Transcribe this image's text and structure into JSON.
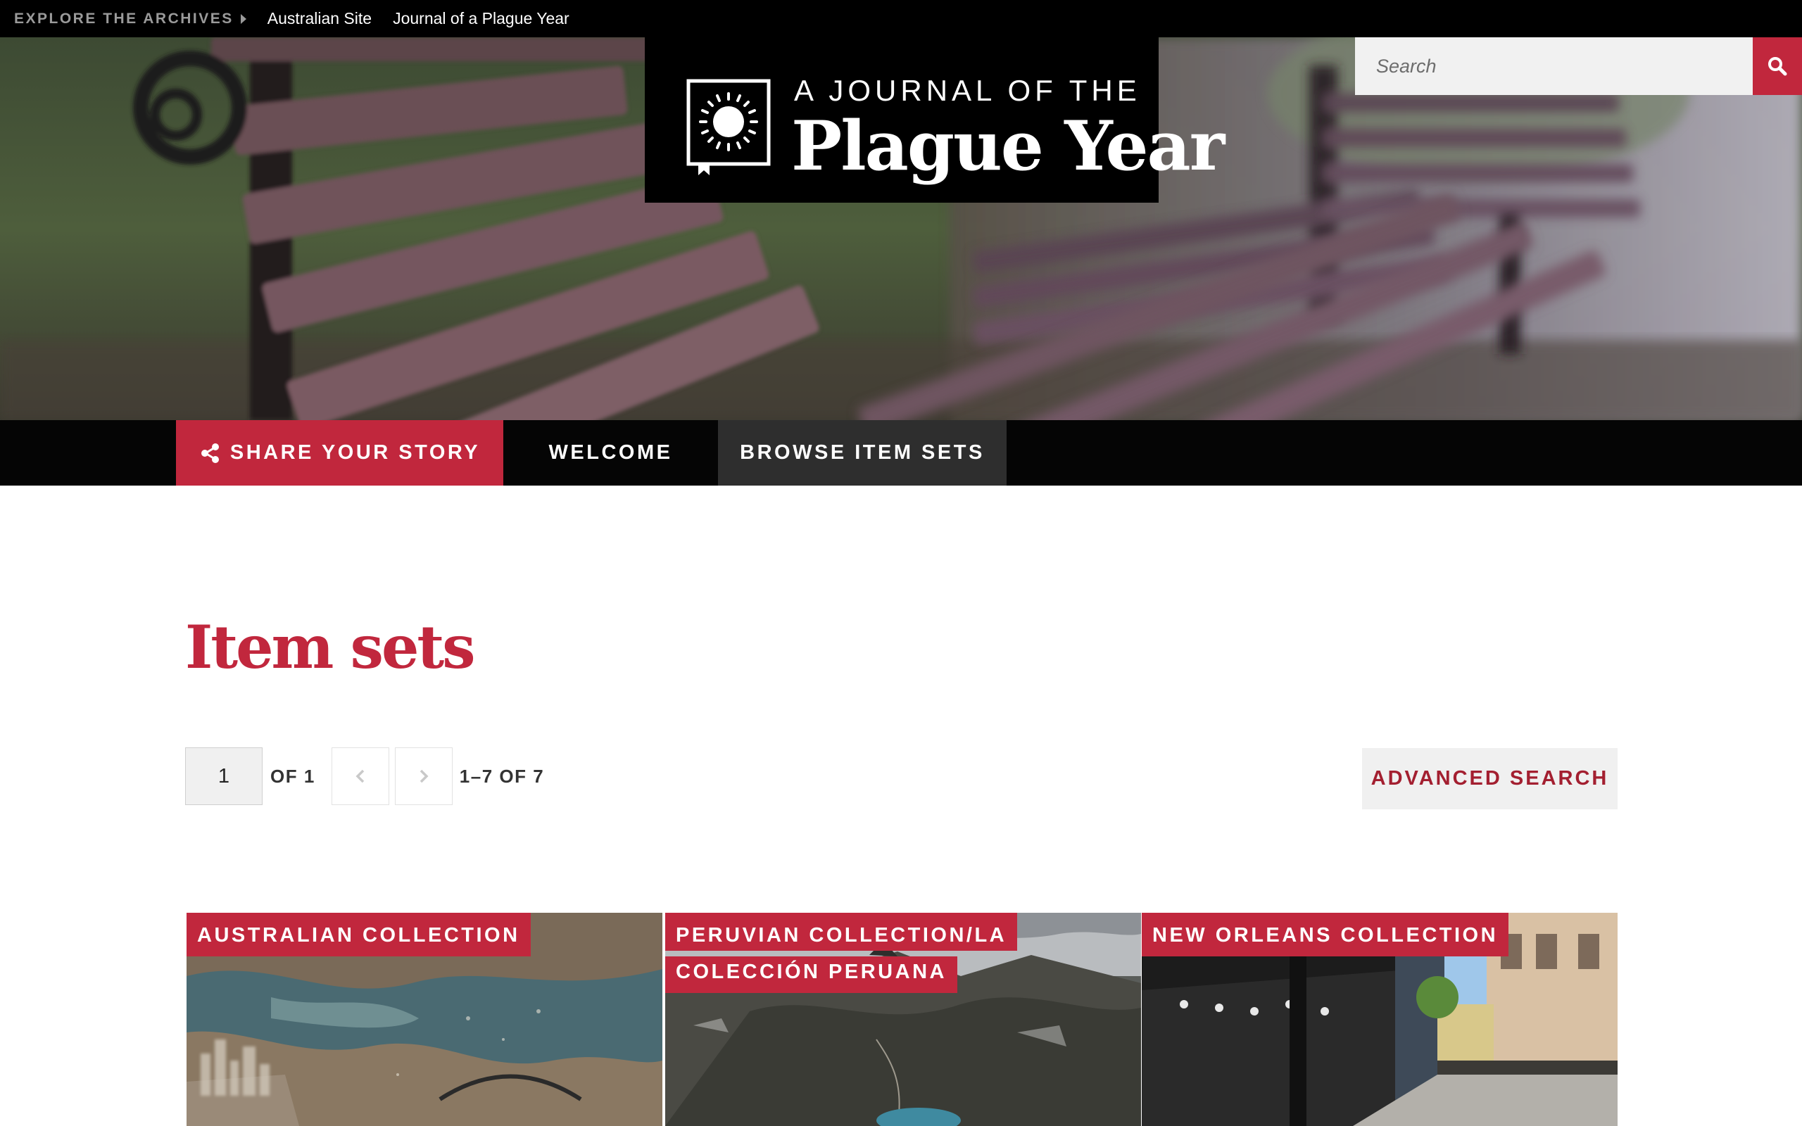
{
  "topbar": {
    "explore_label": "EXPLORE THE ARCHIVES",
    "links": [
      "Australian Site",
      "Journal of a Plague Year"
    ]
  },
  "logo": {
    "small_text": "A JOURNAL OF THE",
    "big_text": "Plague Year"
  },
  "search": {
    "placeholder": "Search"
  },
  "nav": {
    "share": "SHARE YOUR STORY",
    "welcome": "WELCOME",
    "browse": "BROWSE ITEM SETS"
  },
  "main": {
    "title": "Item sets",
    "pagination": {
      "current_page": "1",
      "of_total": "OF 1",
      "range": "1–7 OF 7"
    },
    "advanced_search": "ADVANCED SEARCH"
  },
  "item_sets": [
    {
      "title": "AUSTRALIAN COLLECTION",
      "title_line2": ""
    },
    {
      "title": "PERUVIAN COLLECTION/LA",
      "title_line2": "COLECCIÓN PERUANA"
    },
    {
      "title": "NEW ORLEANS COLLECTION",
      "title_line2": ""
    }
  ],
  "colors": {
    "accent": "#c1273d",
    "nav_bg": "#050505",
    "active_nav_bg": "#2e2e2e"
  },
  "icons": {
    "share": "share-icon",
    "search": "search-icon",
    "prev": "chevron-left-icon",
    "next": "chevron-right-icon",
    "explore": "caret-right-icon"
  }
}
